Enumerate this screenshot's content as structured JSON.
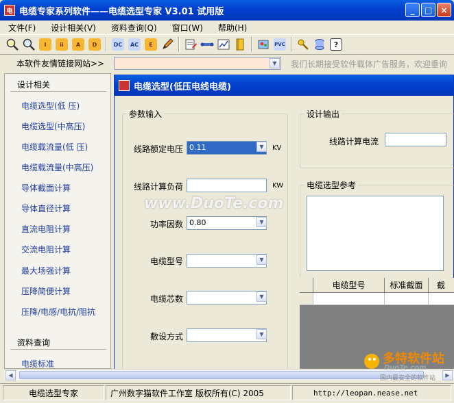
{
  "window": {
    "title": "电缆专家系列软件——电缆选型专家  V3.01 试用版",
    "buttons": {
      "minimize": "_",
      "maximize": "□",
      "close": "×"
    }
  },
  "menu": [
    "文件(F)",
    "设计相关(V)",
    "资料查询(Q)",
    "窗口(W)",
    "帮助(H)"
  ],
  "toolbar": {
    "groups": [
      [
        "zoom-in-icon",
        "zoom-out-icon",
        "i-icon",
        "ii-icon",
        "a-icon",
        "d-icon"
      ],
      [
        "dc-icon",
        "ac-icon",
        "e-icon",
        "pencil-icon"
      ],
      [
        "edit-icon",
        "cable-icon",
        "chart-icon",
        "book-icon"
      ],
      [
        "paint-icon",
        "pvc-icon"
      ],
      [
        "key-icon",
        "database-icon",
        "help-icon"
      ]
    ],
    "button_labels": {
      "dc": "DC",
      "ac": "AC",
      "e": "E",
      "a": "A",
      "d": "D",
      "i": "I",
      "pvc": "PVC",
      "help": "?"
    }
  },
  "linkbar": {
    "label": "本软件友情链接网站>>",
    "combo_value": "",
    "ad_text": "我们长期接受软件载体广告服务，欢迎垂询"
  },
  "sidebar": {
    "design_section": "设计相关",
    "design_items": [
      "电缆选型(低  压)",
      "电缆选型(中高压)",
      "电缆载流量(低  压)",
      "电缆载流量(中高压)",
      "导体截面计算",
      "导体直径计算",
      "直流电阻计算",
      "交流电阻计算",
      "最大场强计算",
      "压降简便计算",
      "压降/电感/电抗/阻抗"
    ],
    "query_section": "资料查询",
    "query_items": [
      "电缆标准"
    ]
  },
  "child_window": {
    "title": "电缆选型(低压电线电缆)",
    "params": {
      "legend": "参数输入",
      "voltage_label": "线路额定电压",
      "voltage_value": "0.11",
      "voltage_unit": "KV",
      "load_label": "线路计算负荷",
      "load_value": "",
      "load_unit": "KW",
      "pf_label": "功率因数",
      "pf_value": "0.80",
      "type_label": "电缆型号",
      "type_value": "",
      "cores_label": "电缆芯数",
      "cores_value": "",
      "laying_label": "敷设方式",
      "laying_value": ""
    },
    "output": {
      "legend": "设计输出",
      "current_label": "线路计算电流",
      "current_value": ""
    },
    "reference": {
      "legend": "电缆选型参考",
      "text": ""
    },
    "grid": {
      "columns": [
        "电缆型号",
        "标准截面",
        "截"
      ]
    }
  },
  "statusbar": {
    "app": "电缆选型专家",
    "copyright": "广州数字猫软件工作室 版权所有(C) 2005",
    "url": "http://leopan.nease.net"
  },
  "overlays": {
    "watermark": "www.DuoTe.com",
    "logo_text": "多特软件站",
    "logo_sub": "DuoTe.com",
    "logo_tag": "国内最安全的软件站"
  }
}
